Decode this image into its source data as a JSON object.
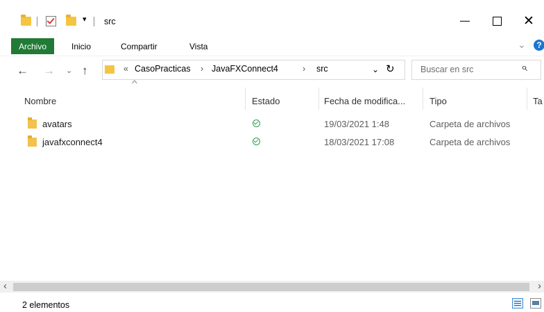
{
  "window": {
    "title": "src",
    "minimize_glyph": "—",
    "close_glyph": "✕"
  },
  "ribbon": {
    "tabs": [
      "Archivo",
      "Inicio",
      "Compartir",
      "Vista"
    ],
    "expand_glyph": "⌄",
    "help_glyph": "?"
  },
  "address": {
    "overflow": "«",
    "crumbs": [
      "CasoPracticas",
      "JavaFXConnect4",
      "src"
    ],
    "separator": "›",
    "dropdown_glyph": "⌄",
    "refresh_glyph": "↻",
    "back_glyph": "←",
    "forward_glyph": "→",
    "recent_glyph": "⌄",
    "up_glyph": "↑"
  },
  "search": {
    "placeholder": "Buscar en src",
    "icon_glyph": "⌕"
  },
  "columns": {
    "name": "Nombre",
    "status": "Estado",
    "date": "Fecha de modifica...",
    "type": "Tipo",
    "size": "Ta",
    "sort_glyph": "^"
  },
  "files": [
    {
      "name": "avatars",
      "date": "19/03/2021 1:48",
      "type": "Carpeta de archivos",
      "status_icon": "sync-ok-icon"
    },
    {
      "name": "javafxconnect4",
      "date": "18/03/2021 17:08",
      "type": "Carpeta de archivos",
      "status_icon": "sync-ok-icon"
    }
  ],
  "scroll": {
    "left_glyph": "‹",
    "right_glyph": "›"
  },
  "status": {
    "count": "2 elementos"
  },
  "colors": {
    "archivo_tab": "#217a35",
    "folder": "#f4c542",
    "status_ok": "#2e9c4e",
    "help": "#1976d2"
  }
}
